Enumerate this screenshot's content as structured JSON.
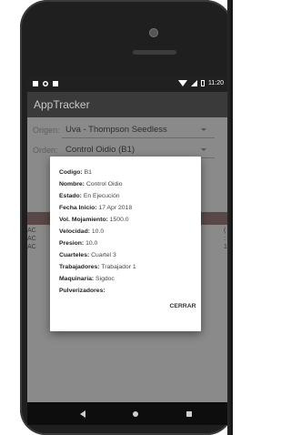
{
  "status_bar": {
    "time": "11:20"
  },
  "app": {
    "title": "AppTracker"
  },
  "origen": {
    "label": "Origen:",
    "value": "Uva - Thompson Seedless"
  },
  "orden": {
    "label": "Orden:",
    "value": "Control Oidio (B1)"
  },
  "background_list": {
    "left_rows": [
      "AC",
      "AC",
      "AC"
    ],
    "right_rows": [
      "(",
      ":",
      "1"
    ]
  },
  "dialog": {
    "fields": [
      {
        "label": "Codigo:",
        "value": "B1"
      },
      {
        "label": "Nombre:",
        "value": "Control Oidio"
      },
      {
        "label": "Estado:",
        "value": "En Ejecución"
      },
      {
        "label": "Fecha Inicio:",
        "value": "17 Apr 2018"
      },
      {
        "label": "Vol. Mojamiento:",
        "value": "1500.0"
      },
      {
        "label": "Velocidad:",
        "value": "10.0"
      },
      {
        "label": "Presion:",
        "value": "10.0"
      },
      {
        "label": "Cuarteles:",
        "value": "Cuartel 3"
      },
      {
        "label": "Trabajadores:",
        "value": "Trabajador 1"
      },
      {
        "label": "Maquinaria:",
        "value": "Sigdoc"
      },
      {
        "label": "Pulverizadores:",
        "value": ""
      }
    ],
    "close_label": "CERRAR"
  }
}
